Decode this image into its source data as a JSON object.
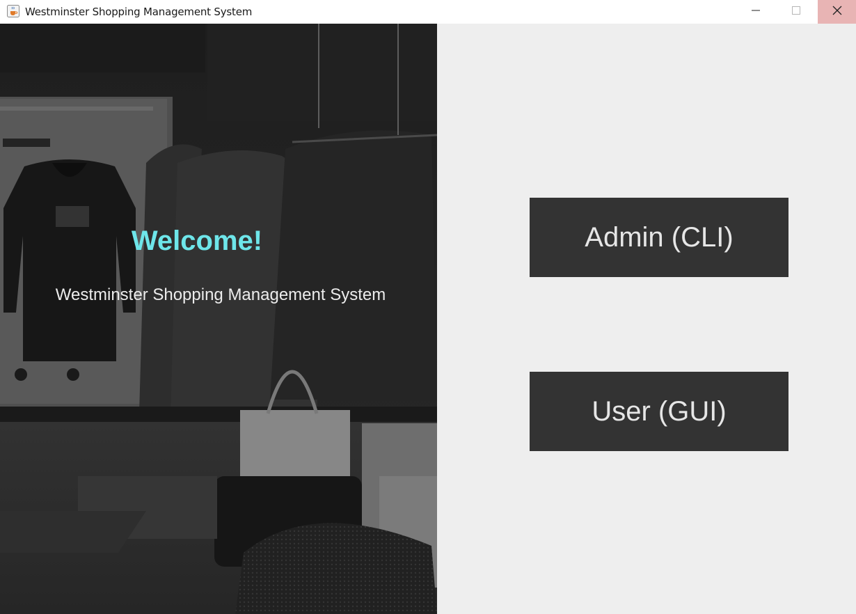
{
  "window": {
    "title": "Westminster Shopping Management System",
    "icon": "java-cup-icon",
    "controls": [
      "minimize-icon",
      "maximize-icon",
      "close-icon"
    ]
  },
  "hero": {
    "image": "fashion-store-photo",
    "welcome": "Welcome!",
    "subtitle": "Westminster Shopping Management System"
  },
  "actions": {
    "admin_label": "Admin (CLI)",
    "user_label": "User (GUI)"
  },
  "colors": {
    "accent": "#6ee6ea",
    "button_bg": "#333333",
    "button_text": "#e6e6e6",
    "panel_bg": "#eeeeee",
    "close_hover": "#e8b4b4"
  }
}
